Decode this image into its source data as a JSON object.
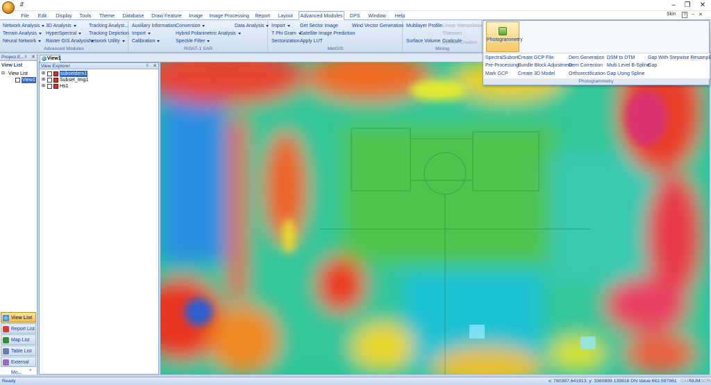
{
  "title_bar": {
    "quick_access": "⇵"
  },
  "menu": [
    "File",
    "Edit",
    "Display",
    "Tools",
    "Theme",
    "Database",
    "Draw Feature",
    "Image",
    "Image Processing",
    "Report",
    "Layout",
    "Advanced Modules",
    "GPS",
    "Window",
    "Help"
  ],
  "skin_label": "Skin",
  "ribbon": {
    "advanced_modules": {
      "title": "Advanced Modules",
      "items": [
        "Network Analysis",
        "Terrain Analysis",
        "Neural Network",
        "3D Analysis",
        "HyperSpectral",
        "Raster GIS Analysis",
        "Tracking Analyst...",
        "Tracking Depiction",
        "Network Utility"
      ]
    },
    "risat": {
      "title": "RISAT-1 SAR",
      "items": [
        "Auxiliary Information",
        "Import",
        "Calibration",
        "Conversion",
        "Hybrid Polarimetric Analysis",
        "Speckle Filter",
        "Data Analysis"
      ]
    },
    "metgis": {
      "title": "MetGIS",
      "items": [
        "Import",
        "T Phi Gram",
        "Sectorization",
        "Get Sector Image",
        "Satellite Image Prediction",
        "Apply LUT",
        "Wind Vector Generation"
      ]
    },
    "mining": {
      "title": "Mining",
      "items": [
        "Multilayer Profile",
        "Surface Volume",
        "Linear Interpolation",
        "Thiessen",
        "Graticule",
        "Cylinder Creation"
      ]
    }
  },
  "photogrammetry": {
    "button_label": "Photogrammetry",
    "title": "Photogrammetry",
    "items": [
      "SpectralSubset",
      "Pre-Processing",
      "Mark GCP",
      "Create GCP File",
      "Bundle Block Adjustment",
      "Create 3D Model",
      "Dem Generation",
      "Dem Correction",
      "Orthorectification",
      "DSM to DTM",
      "Multi Level B-Spline",
      "Gap Using Spline",
      "Gap With Stepwise Resampling",
      "Gap"
    ]
  },
  "project_panel": {
    "title": "Project E...",
    "view_list_label": "View List",
    "tree_root": "View List",
    "tree_child": "View1"
  },
  "nav_buttons": [
    "View List",
    "Report List",
    "Map List",
    "Table List",
    "External Mo..."
  ],
  "view_explorer": {
    "title": "View Explorer",
    "layers": [
      "subsetdem1",
      "Subset_Img1",
      "Hs1"
    ]
  },
  "view_tab": "View1",
  "status": {
    "left": "Ready",
    "coords": "x: 780397.641913;  y: 3360899.139818  DN Value:662.597961",
    "indicators": [
      "CAP",
      "NUM",
      "SCRL"
    ]
  }
}
